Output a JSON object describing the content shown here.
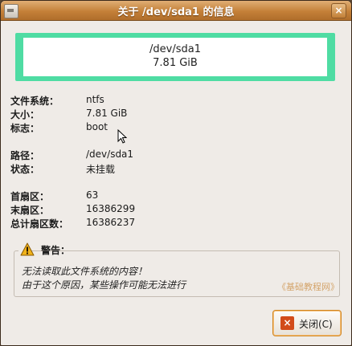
{
  "window": {
    "title": "关于 /dev/sda1 的信息",
    "close_glyph": "×"
  },
  "partition": {
    "name": "/dev/sda1",
    "size": "7.81 GiB",
    "color": "#4fdca3"
  },
  "properties": {
    "filesystem": {
      "label": "文件系统：",
      "value": "ntfs"
    },
    "size": {
      "label": "大小：",
      "value": "7.81 GiB"
    },
    "flags": {
      "label": "标志：",
      "value": "boot"
    },
    "path": {
      "label": "路径：",
      "value": "/dev/sda1"
    },
    "status": {
      "label": "状态：",
      "value": "未挂载"
    },
    "first_sector": {
      "label": "首扇区：",
      "value": "63"
    },
    "last_sector": {
      "label": "末扇区：",
      "value": "16386299"
    },
    "total_sectors": {
      "label": "总计扇区数：",
      "value": "16386237"
    }
  },
  "warning": {
    "title": "警告：",
    "line1": "无法读取此文件系统的内容！",
    "line2": "由于这个原因，某些操作可能无法进行",
    "icon": "warning-icon"
  },
  "watermark": "《基础教程网》",
  "buttons": {
    "close_label": "关闭(C)",
    "close_icon_glyph": "×"
  }
}
